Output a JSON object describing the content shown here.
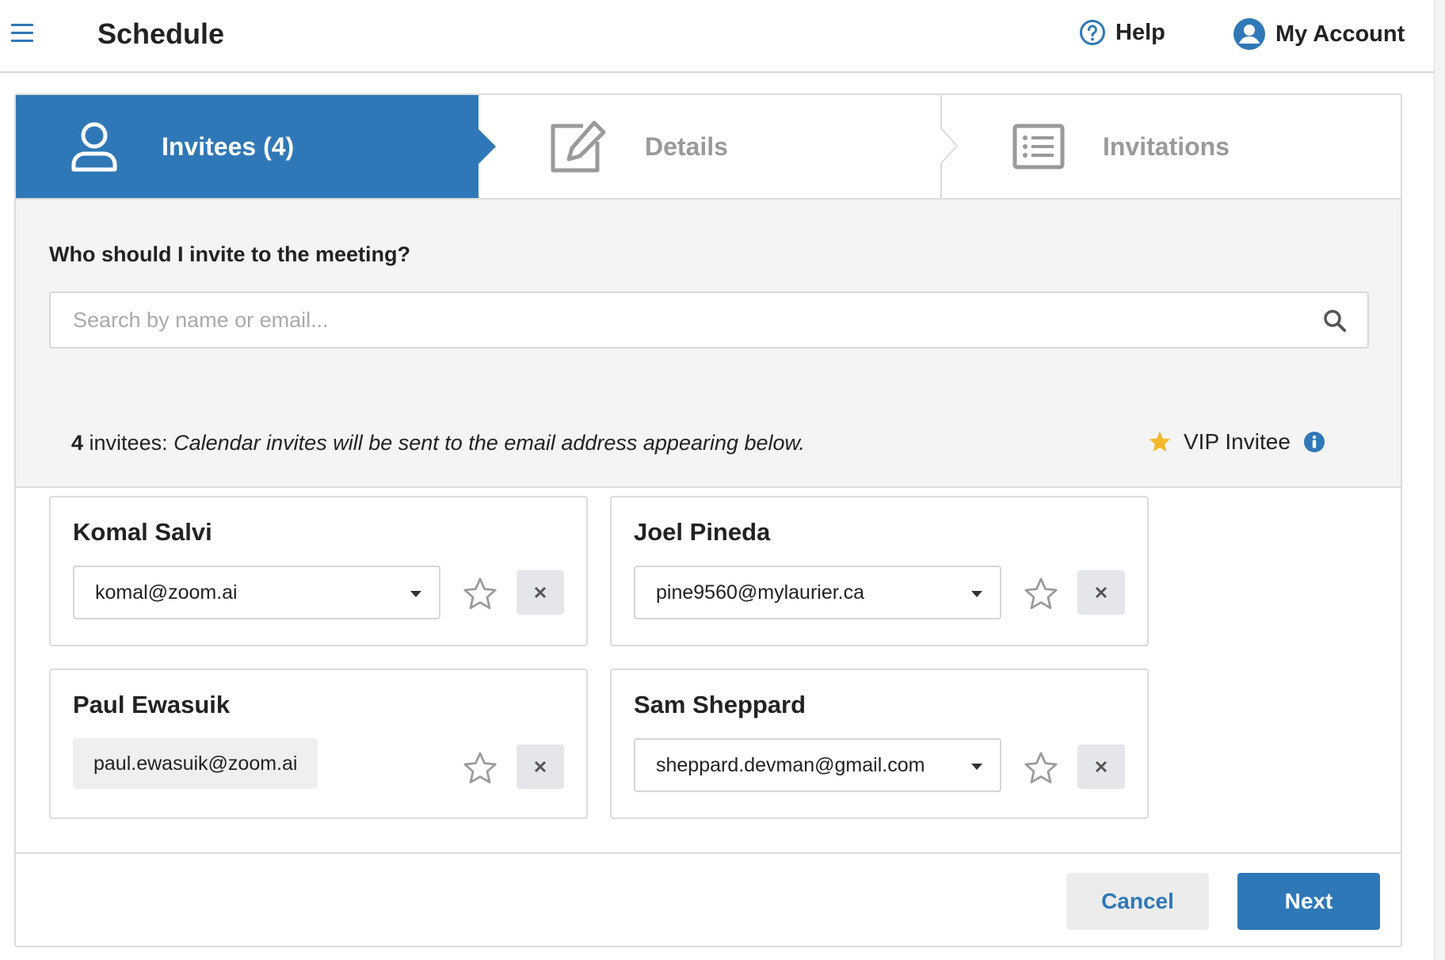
{
  "header": {
    "title": "Schedule",
    "help_label": "Help",
    "account_label": "My Account"
  },
  "stepper": {
    "steps": [
      {
        "label": "Invitees (4)",
        "icon": "user-icon",
        "active": true
      },
      {
        "label": "Details",
        "icon": "edit-icon",
        "active": false
      },
      {
        "label": "Invitations",
        "icon": "list-icon",
        "active": false
      }
    ]
  },
  "question": {
    "text": "Who should I invite to the meeting?",
    "search_placeholder": "Search by name or email..."
  },
  "summary": {
    "count": "4",
    "prefix": " invitees: ",
    "message": "Calendar invites will be sent to the email address appearing below."
  },
  "vip": {
    "label": "VIP Invitee"
  },
  "invitees": [
    {
      "name": "Komal Salvi",
      "email": "komal@zoom.ai",
      "selectable": true
    },
    {
      "name": "Joel Pineda",
      "email": "pine9560@mylaurier.ca",
      "selectable": true
    },
    {
      "name": "Paul Ewasuik",
      "email": "paul.ewasuik@zoom.ai",
      "selectable": false
    },
    {
      "name": "Sam Sheppard",
      "email": "sheppard.devman@gmail.com",
      "selectable": true
    }
  ],
  "footer": {
    "cancel_label": "Cancel",
    "next_label": "Next"
  },
  "colors": {
    "accent": "#2f78b7",
    "star_vip": "#f2b72a",
    "muted": "#9a9a9a"
  }
}
